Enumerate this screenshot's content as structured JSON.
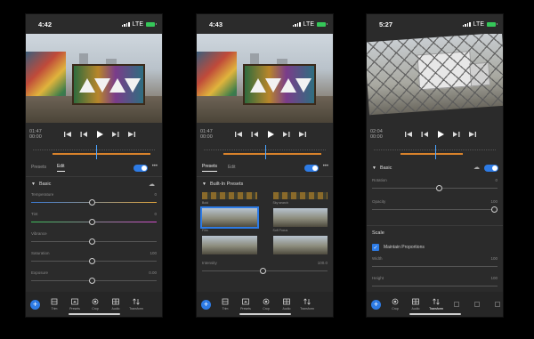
{
  "screens": [
    {
      "status": {
        "time": "4:42",
        "network": "LTE"
      },
      "timecode": {
        "current": "01:47",
        "total": "00:00"
      },
      "tabs": [
        "Presets",
        "Edit"
      ],
      "active_tab": 1,
      "section": "Basic",
      "sliders": [
        {
          "label": "Temperature",
          "value": "0",
          "position": 0.5,
          "colors": [
            "#3b7bd6",
            "#e0a43c"
          ]
        },
        {
          "label": "Tint",
          "value": "0",
          "position": 0.5,
          "colors": [
            "#3cbf5a",
            "#d44ccc"
          ]
        },
        {
          "label": "Vibrance",
          "value": "",
          "position": 0.5,
          "colors": [
            "#555555",
            "#555555"
          ]
        },
        {
          "label": "Saturation",
          "value": "100",
          "position": 0.5,
          "colors": [
            "#555555",
            "#555555"
          ]
        },
        {
          "label": "Exposure",
          "value": "0.00",
          "position": 0.5,
          "colors": [
            "#555555",
            "#555555"
          ]
        }
      ],
      "tools": [
        "Trim",
        "Presets",
        "Crop",
        "Audio",
        "Transform"
      ]
    },
    {
      "status": {
        "time": "4:43",
        "network": "LTE"
      },
      "timecode": {
        "current": "01:47",
        "total": "00:00"
      },
      "tabs": [
        "Presets",
        "Edit"
      ],
      "active_tab": 0,
      "section": "Built-In Presets",
      "presets": [
        "Bold",
        "Sky search",
        "Film",
        "Soft Focus",
        "",
        ""
      ],
      "selected_preset": 2,
      "intensity": {
        "label": "Intensity",
        "value": "100.0",
        "position": 0.5
      },
      "tools": [
        "Trim",
        "Presets",
        "Crop",
        "Audio",
        "Transform"
      ]
    },
    {
      "status": {
        "time": "5:27",
        "network": "LTE"
      },
      "timecode": {
        "current": "02:04",
        "total": "00:00"
      },
      "section": "Basic",
      "sliders": [
        {
          "label": "Rotation",
          "value": "0",
          "position": 0.55
        },
        {
          "label": "Opacity",
          "value": "100",
          "position": 1.0
        }
      ],
      "scale_heading": "Scale",
      "maintain_proportions": "Maintain Proportions",
      "scale_sliders": [
        {
          "label": "Width",
          "value": "100"
        },
        {
          "label": "Height",
          "value": "100"
        }
      ],
      "tools": [
        "Crop",
        "Audio",
        "Transform"
      ],
      "active_tool": 2
    }
  ],
  "accent": "#2d7be5",
  "timeline_color": "#d9822b"
}
